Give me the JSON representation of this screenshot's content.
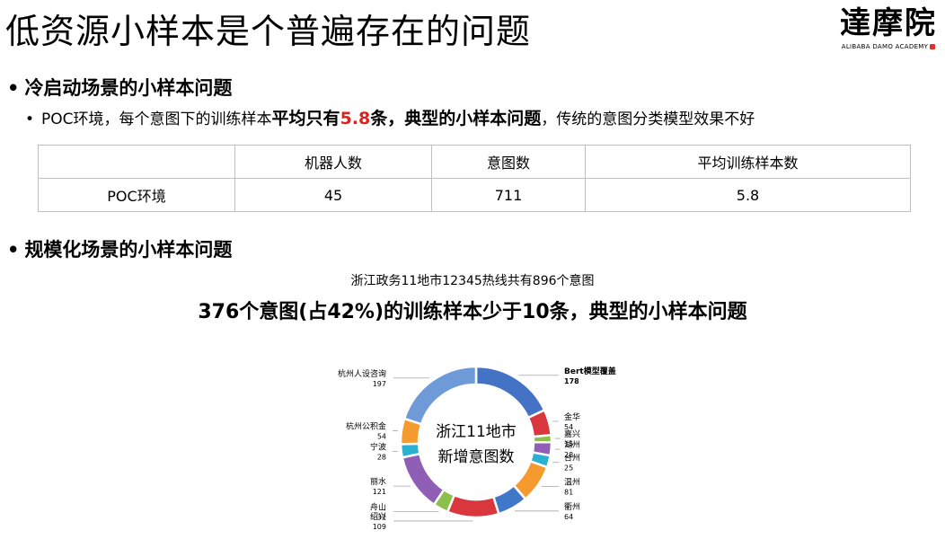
{
  "title": "低资源小样本是个普遍存在的问题",
  "logo": {
    "cn": "達摩院",
    "en": "ALIBABA DAMO ACADEMY"
  },
  "section1": {
    "heading": "冷启动场景的小样本问题",
    "bullet": {
      "prefix": "POC环境，每个意图下的训练样本",
      "bold1": "平均只有",
      "highlight": "5.8",
      "bold2": "条，典型的小样本问题",
      "suffix": "，传统的意图分类模型效果不好"
    }
  },
  "table": {
    "headers": [
      "",
      "机器人数",
      "意图数",
      "平均训练样本数"
    ],
    "rows": [
      [
        "POC环境",
        "45",
        "711",
        "5.8"
      ]
    ]
  },
  "section2": {
    "heading": "规模化场景的小样本问题",
    "subtitle": "浙江政务11地市12345热线共有896个意图",
    "headline": "376个意图(占42%)的训练样本少于10条，典型的小样本问题"
  },
  "chart_data": {
    "type": "pie",
    "center_text": [
      "浙江11地市",
      "新增意图数"
    ],
    "slices": [
      {
        "label": "Bert模型覆盖",
        "value": 178,
        "color": "#4472c4"
      },
      {
        "label": "金华",
        "value": 54,
        "color": "#d9363e"
      },
      {
        "label": "嘉兴",
        "value": 15,
        "color": "#8cc04b"
      },
      {
        "label": "湖州",
        "value": 28,
        "color": "#8e5fb4"
      },
      {
        "label": "台州",
        "value": 25,
        "color": "#2ab0d0"
      },
      {
        "label": "温州",
        "value": 81,
        "color": "#f59a2e"
      },
      {
        "label": "衢州",
        "value": 64,
        "color": "#3f78c8"
      },
      {
        "label": "绍兴",
        "value": 109,
        "color": "#d9363e"
      },
      {
        "label": "舟山",
        "value": 32,
        "color": "#8cc04b"
      },
      {
        "label": "丽水",
        "value": 121,
        "color": "#8e5fb4"
      },
      {
        "label": "宁波",
        "value": 28,
        "color": "#2ab0d0"
      },
      {
        "label": "杭州公积金",
        "value": 54,
        "color": "#f59a2e"
      },
      {
        "label": "杭州人设咨询",
        "value": 197,
        "color": "#6f9ad8"
      }
    ]
  }
}
